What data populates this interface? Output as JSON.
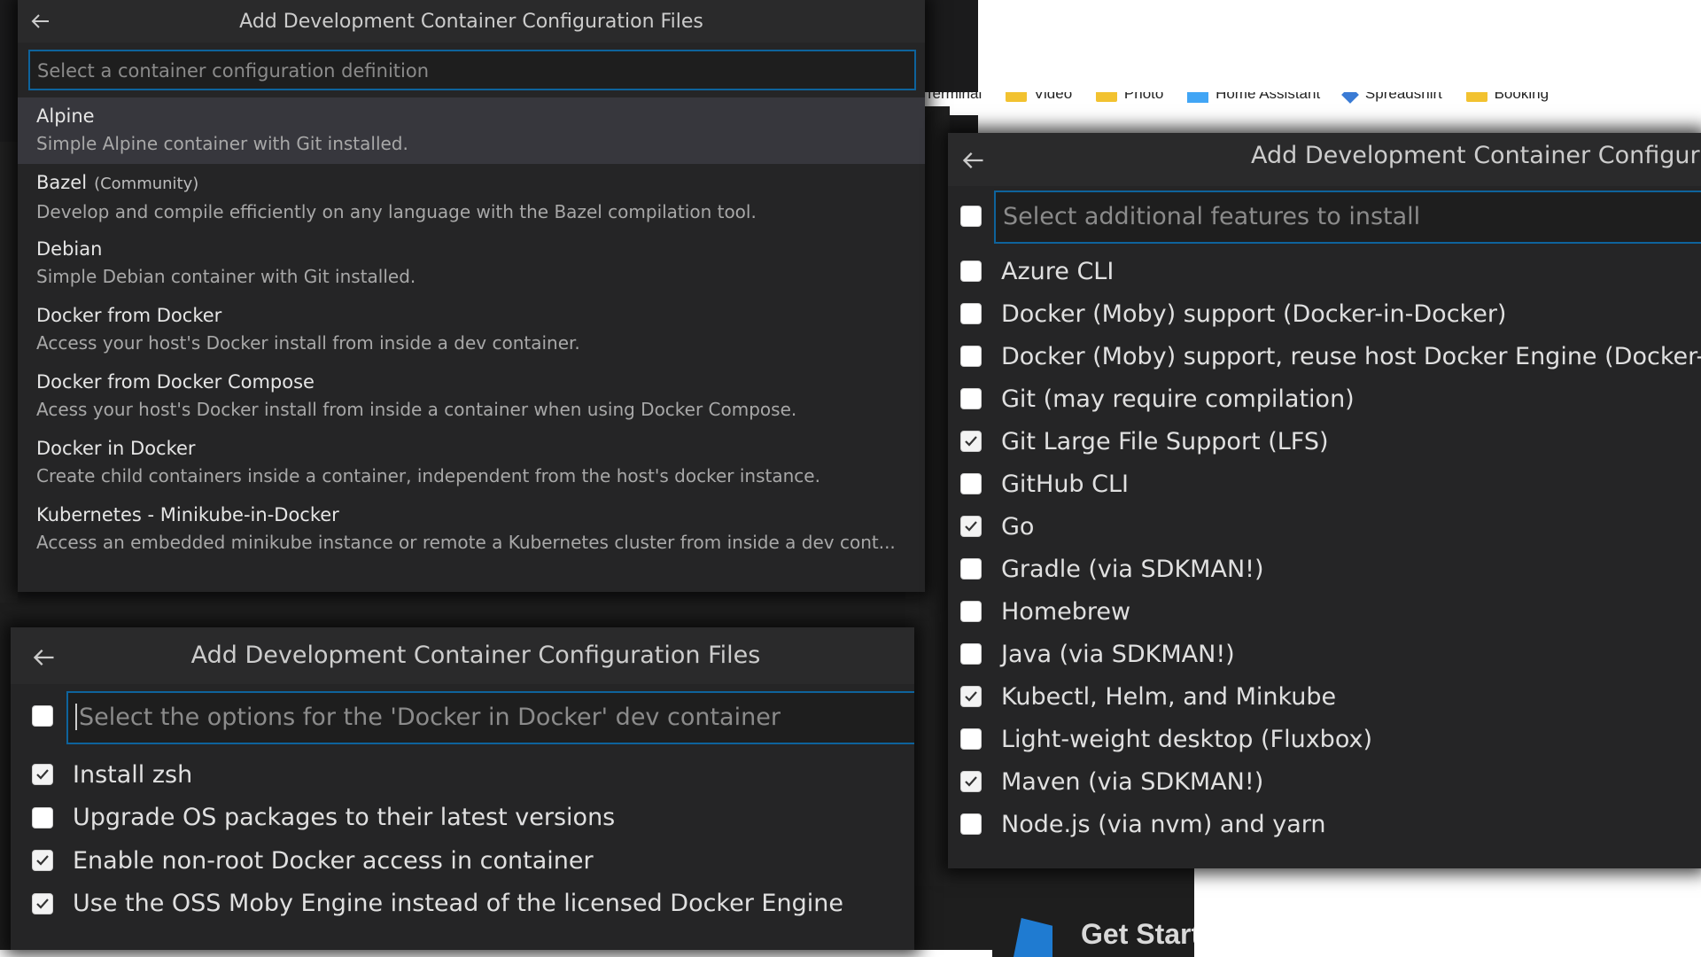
{
  "background": {
    "bookmarks": [
      "Terminal",
      "Video",
      "Photo",
      "Home Assistant",
      "Spreadshirt",
      "Booking"
    ],
    "get_started": "Get Started"
  },
  "panel_top": {
    "title": "Add Development Container Configuration Files",
    "placeholder": "Select a container configuration definition",
    "items": [
      {
        "label": "Alpine",
        "tag": "",
        "description": "Simple Alpine container with Git installed.",
        "selected": true
      },
      {
        "label": "Bazel",
        "tag": "(Community)",
        "description": "Develop and compile efficiently on any language with the Bazel compilation tool.",
        "selected": false
      },
      {
        "label": "Debian",
        "tag": "",
        "description": "Simple Debian container with Git installed.",
        "selected": false
      },
      {
        "label": "Docker from Docker",
        "tag": "",
        "description": "Access your host's Docker install from inside a dev container.",
        "selected": false
      },
      {
        "label": "Docker from Docker Compose",
        "tag": "",
        "description": "Acess your host's Docker install from inside a container when using Docker Compose.",
        "selected": false
      },
      {
        "label": "Docker in Docker",
        "tag": "",
        "description": "Create child containers inside a container, independent from the host's docker instance.",
        "selected": false
      },
      {
        "label": "Kubernetes - Minikube-in-Docker",
        "tag": "",
        "description": "Access an embedded minikube instance or remote a Kubernetes cluster from inside a dev cont...",
        "selected": false
      }
    ]
  },
  "panel_features": {
    "title": "Add Development Container Configura",
    "placeholder": "Select additional features to install",
    "select_all_checked": false,
    "items": [
      {
        "label": "Azure CLI",
        "checked": false
      },
      {
        "label": "Docker (Moby) support (Docker-in-Docker)",
        "checked": false
      },
      {
        "label": "Docker (Moby) support, reuse host Docker Engine (Docker-fr",
        "checked": false
      },
      {
        "label": "Git (may require compilation)",
        "checked": false
      },
      {
        "label": "Git Large File Support (LFS)",
        "checked": true
      },
      {
        "label": "GitHub CLI",
        "checked": false
      },
      {
        "label": "Go",
        "checked": true
      },
      {
        "label": "Gradle (via SDKMAN!)",
        "checked": false
      },
      {
        "label": "Homebrew",
        "checked": false
      },
      {
        "label": "Java (via SDKMAN!)",
        "checked": false
      },
      {
        "label": "Kubectl, Helm, and Minkube",
        "checked": true
      },
      {
        "label": "Light-weight desktop (Fluxbox)",
        "checked": false
      },
      {
        "label": "Maven (via SDKMAN!)",
        "checked": true
      },
      {
        "label": "Node.js (via nvm) and yarn",
        "checked": false
      }
    ]
  },
  "panel_options": {
    "title": "Add Development Container Configuration Files",
    "placeholder": "Select the options for the 'Docker in Docker' dev container",
    "select_all_checked": false,
    "items": [
      {
        "label": "Install zsh",
        "checked": true
      },
      {
        "label": "Upgrade OS packages to their latest versions",
        "checked": false
      },
      {
        "label": "Enable non-root Docker access in container",
        "checked": true
      },
      {
        "label": "Use the OSS Moby Engine instead of the licensed Docker Engine",
        "checked": true
      }
    ]
  }
}
